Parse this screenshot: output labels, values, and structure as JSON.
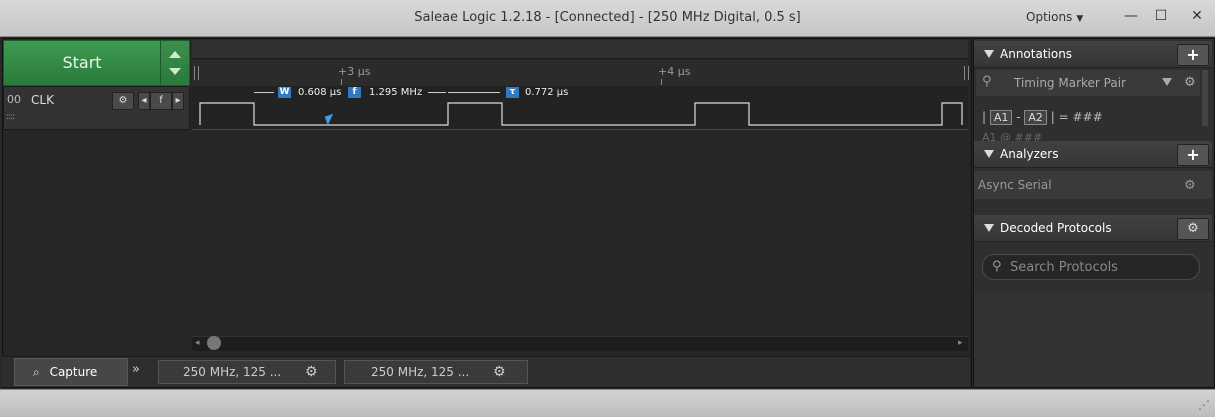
{
  "window": {
    "title": "Saleae Logic 1.2.18 - [Connected] - [250 MHz Digital, 0.5 s]",
    "options_label": "Options",
    "minimize_glyph": "—",
    "maximize_glyph": "☐",
    "close_glyph": "✕"
  },
  "capture": {
    "start_label": "Start"
  },
  "timeline": {
    "ticks": [
      "+3 µs",
      "+4 µs"
    ]
  },
  "channel": {
    "number": "00",
    "name": "CLK",
    "edge_glyph": "f"
  },
  "measurements": {
    "width_badge": "W",
    "width_value": "0.608 µs",
    "freq_badge": "f",
    "freq_value": "1.295 MHz",
    "period_badge": "τ",
    "period_value": "0.772 µs"
  },
  "tabs": {
    "capture_label": "Capture",
    "more_glyph": "»",
    "session_tabs": [
      "250 MHz, 125 ...",
      "250 MHz, 125 ..."
    ]
  },
  "annotations": {
    "header": "Annotations",
    "timing_marker": "Timing Marker Pair",
    "formula_a1": "A1",
    "formula_sep": "-",
    "formula_a2": "A2",
    "formula_result": "| = ###",
    "formula_line2": "A1  @  ###"
  },
  "analyzers": {
    "header": "Analyzers",
    "items": [
      "Async Serial"
    ]
  },
  "decoded": {
    "header": "Decoded Protocols",
    "search_placeholder": "Search Protocols"
  },
  "icons": {
    "gear": "gear-icon",
    "plus": "plus-icon",
    "search": "search-icon",
    "pin": "pin-icon"
  }
}
